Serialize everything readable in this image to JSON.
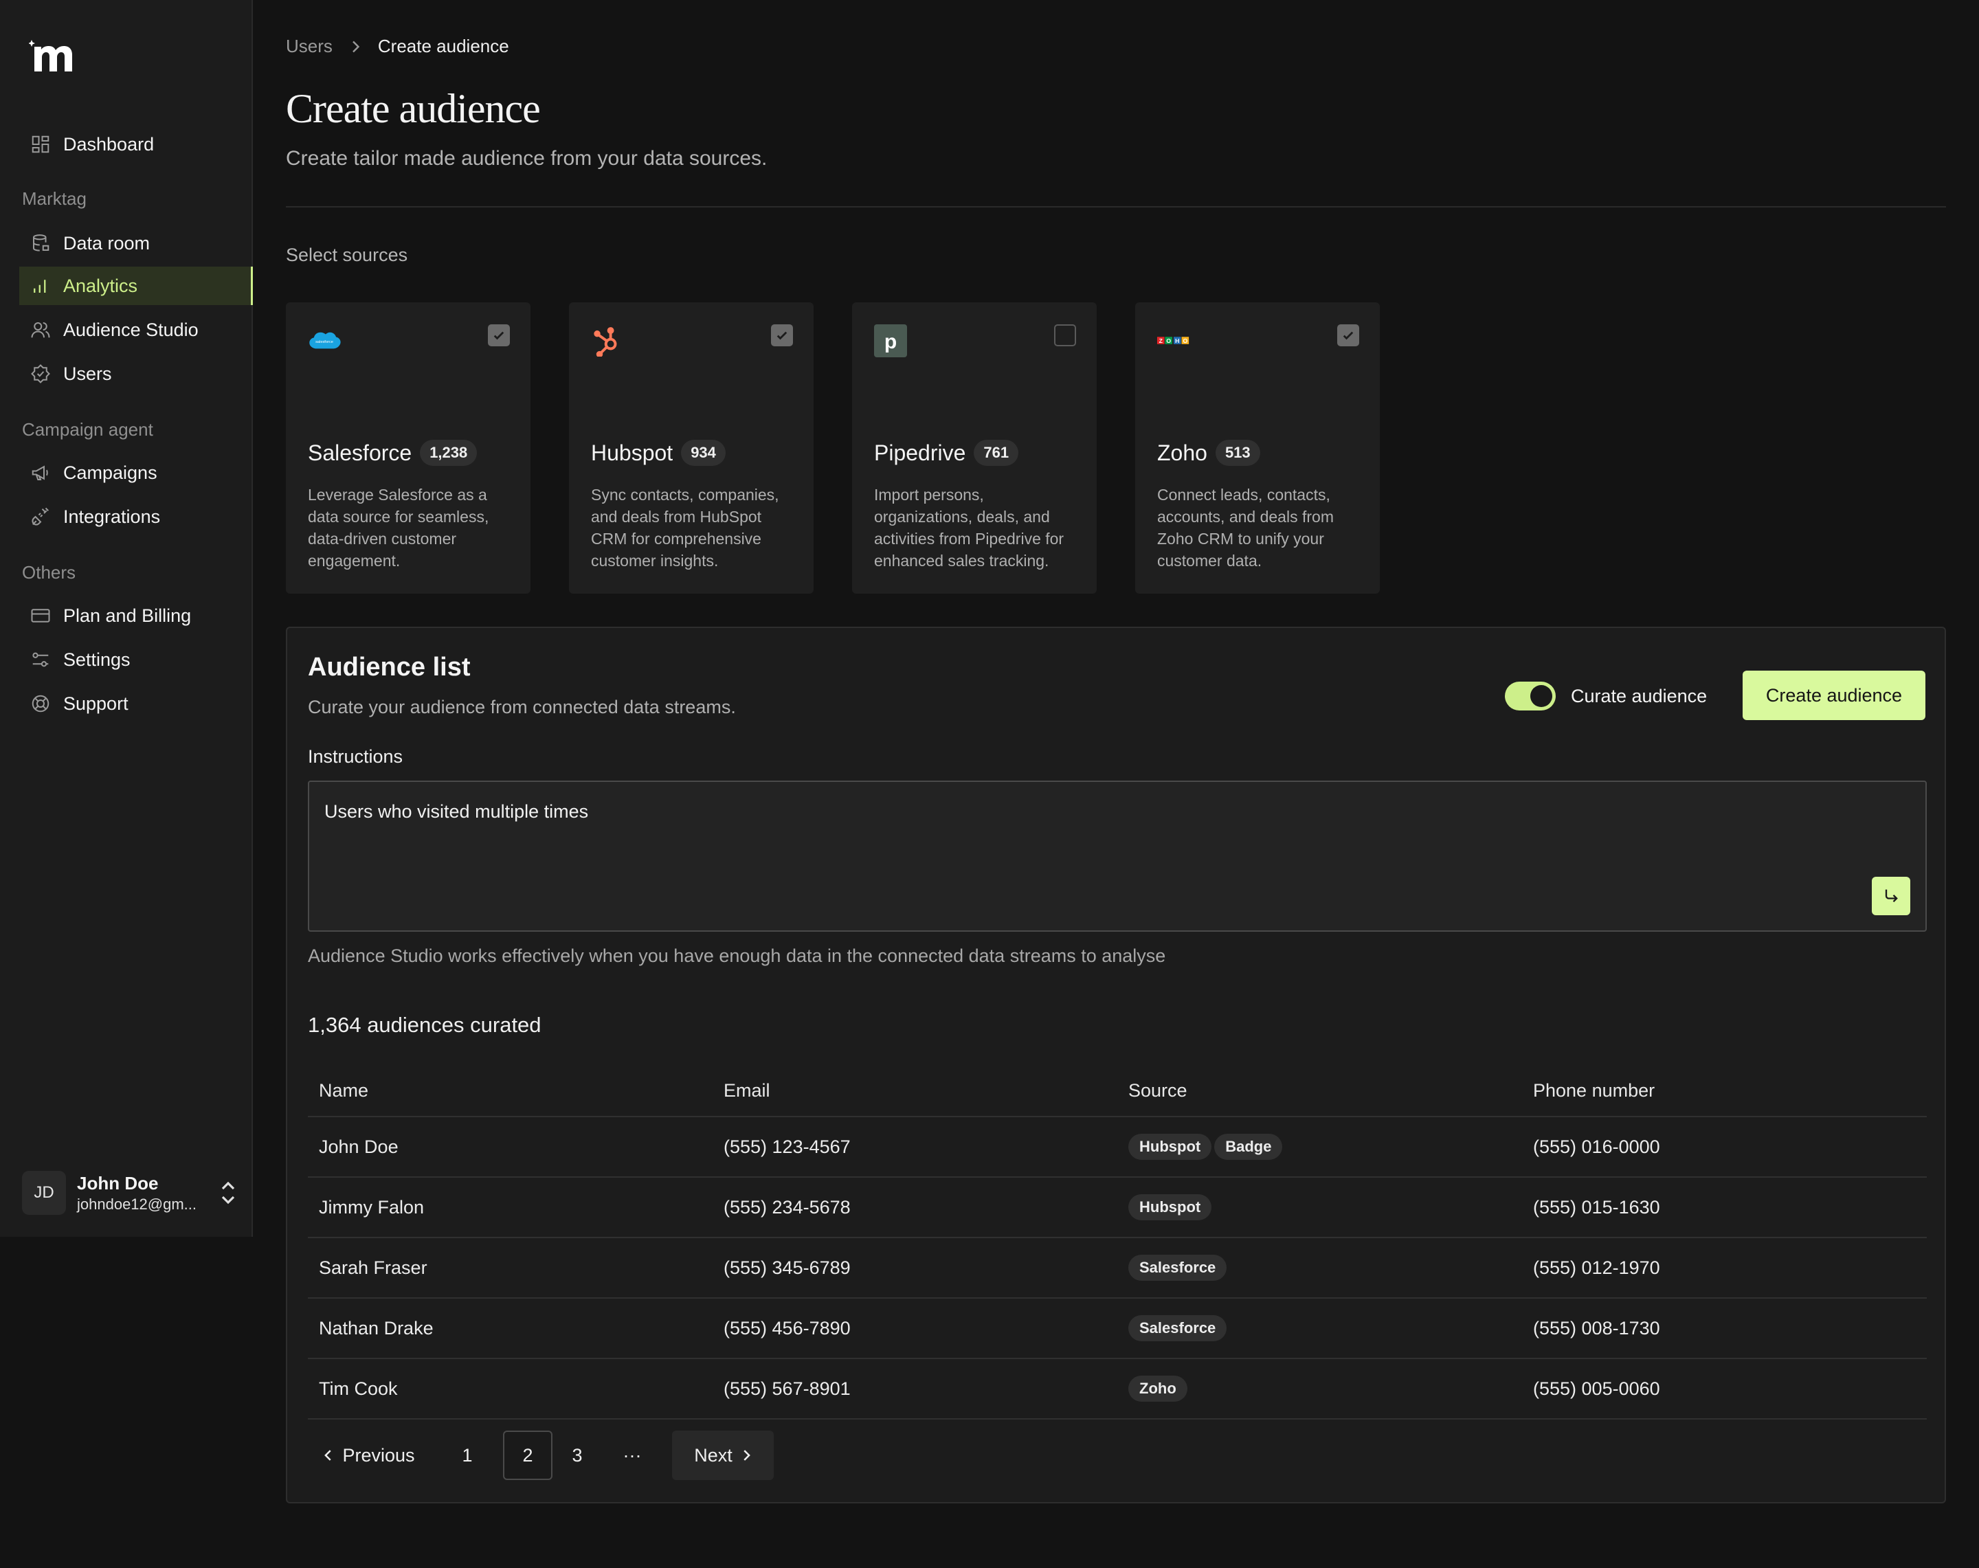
{
  "sidebar": {
    "logo": "marktag-logo",
    "items": [
      {
        "label": "Dashboard",
        "icon": "grid-icon"
      },
      {
        "label": "Data room",
        "icon": "database-icon"
      },
      {
        "label": "Analytics",
        "icon": "bar-chart-icon",
        "active": true
      },
      {
        "label": "Audience Studio",
        "icon": "users-icon"
      },
      {
        "label": "Users",
        "icon": "badge-icon"
      },
      {
        "label": "Campaigns",
        "icon": "megaphone-icon"
      },
      {
        "label": "Integrations",
        "icon": "plug-icon"
      },
      {
        "label": "Plan and Billing",
        "icon": "credit-card-icon"
      },
      {
        "label": "Settings",
        "icon": "sliders-icon"
      },
      {
        "label": "Support",
        "icon": "life-buoy-icon"
      }
    ],
    "sections": [
      "Marktag",
      "Campaign agent",
      "Others"
    ],
    "user": {
      "initials": "JD",
      "name": "John Doe",
      "email": "johndoe12@gm..."
    }
  },
  "breadcrumb": {
    "parent": "Users",
    "current": "Create audience"
  },
  "page": {
    "title": "Create audience",
    "subtitle": "Create tailor made audience from your data sources.",
    "select_label": "Select sources"
  },
  "sources": [
    {
      "name": "Salesforce",
      "count": "1,238",
      "checked": true,
      "desc": "Leverage Salesforce as a data source for seamless, data-driven customer engagement."
    },
    {
      "name": "Hubspot",
      "count": "934",
      "checked": true,
      "desc": "Sync contacts, companies, and deals from HubSpot CRM for comprehensive customer insights."
    },
    {
      "name": "Pipedrive",
      "count": "761",
      "checked": false,
      "desc": "Import persons, organizations, deals, and activities from Pipedrive for enhanced sales tracking."
    },
    {
      "name": "Zoho",
      "count": "513",
      "checked": true,
      "desc": "Connect leads, contacts, accounts, and deals from Zoho CRM to unify your customer data."
    }
  ],
  "audience": {
    "title": "Audience list",
    "subtitle": "Curate your audience from connected data streams.",
    "toggle_label": "Curate audience",
    "create_label": "Create audience",
    "instructions_label": "Instructions",
    "instructions_value": "Users who visited multiple times",
    "hint": "Audience Studio works effectively when you have enough data in the connected data streams to analyse",
    "count_text": "1,364 audiences curated",
    "columns": [
      "Name",
      "Email",
      "Source",
      "Phone number"
    ],
    "rows": [
      {
        "name": "John Doe",
        "email": "(555) 123-4567",
        "sources": [
          "Hubspot",
          "Badge"
        ],
        "phone": "(555) 016-0000"
      },
      {
        "name": "Jimmy Falon",
        "email": "(555) 234-5678",
        "sources": [
          "Hubspot"
        ],
        "phone": "(555) 015-1630"
      },
      {
        "name": "Sarah Fraser",
        "email": "(555) 345-6789",
        "sources": [
          "Salesforce"
        ],
        "phone": "(555) 012-1970"
      },
      {
        "name": "Nathan Drake",
        "email": "(555) 456-7890",
        "sources": [
          "Salesforce"
        ],
        "phone": "(555) 008-1730"
      },
      {
        "name": "Tim Cook",
        "email": "(555) 567-8901",
        "sources": [
          "Zoho"
        ],
        "phone": "(555) 005-0060"
      }
    ]
  },
  "pagination": {
    "previous": "Previous",
    "pages": [
      "1",
      "2",
      "3"
    ],
    "current": "2",
    "ellipsis": "···",
    "next": "Next"
  },
  "colors": {
    "accent": "#d9f99d",
    "background": "#131313",
    "sidebar": "#1c1c1c",
    "card": "#1f1f1f"
  }
}
